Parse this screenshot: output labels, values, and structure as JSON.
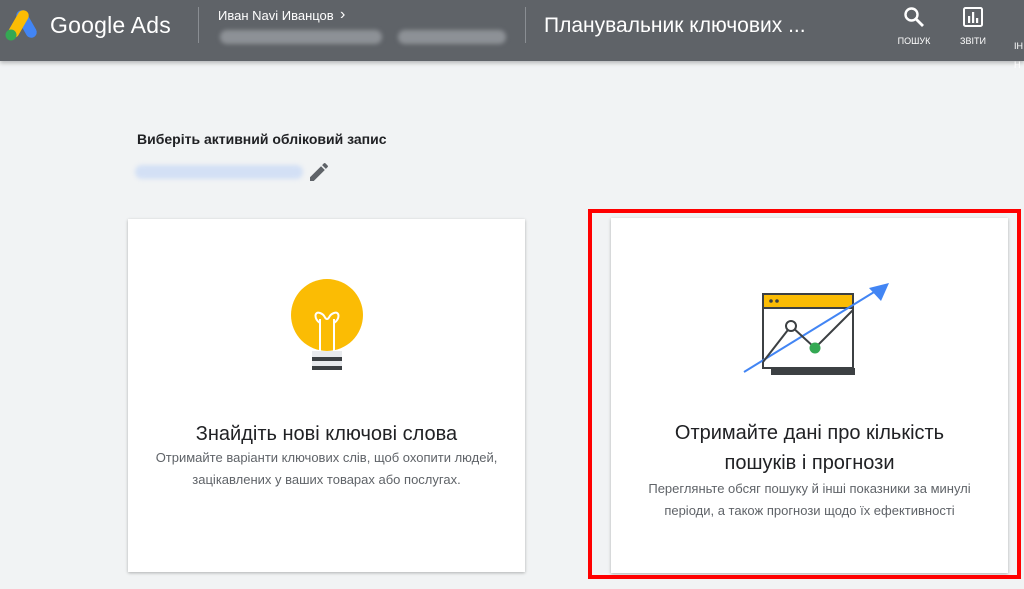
{
  "header": {
    "brand": "Google Ads",
    "account_name": "Иван Navi Иванцов",
    "page_title": "Планувальник ключових ...",
    "actions": [
      {
        "label": "ПОШУК",
        "icon": "search-icon"
      },
      {
        "label": "ЗВІТИ",
        "icon": "reports-icon"
      }
    ],
    "cut_off_text": "ІН\nН"
  },
  "account_select": {
    "label": "Виберіть активний обліковий запис"
  },
  "cards": [
    {
      "icon": "lightbulb-icon",
      "title": "Знайдіть нові ключові слова",
      "description": "Отримайте варіанти ключових слів, щоб охопити людей, зацікавлених у ваших товарах або послугах."
    },
    {
      "icon": "forecast-chart-icon",
      "title": "Отримайте дані про кількість пошуків і прогнози",
      "description": "Перегляньте обсяг пошуку й інші показники за минулі періоди, а також прогнози щодо їх ефективності"
    }
  ],
  "colors": {
    "topbar": "#5f6368",
    "background": "#f1f3f4",
    "highlight": "#ff0000",
    "bulb": "#fbbc04",
    "arrow": "#4285f4",
    "point": "#34a853"
  }
}
